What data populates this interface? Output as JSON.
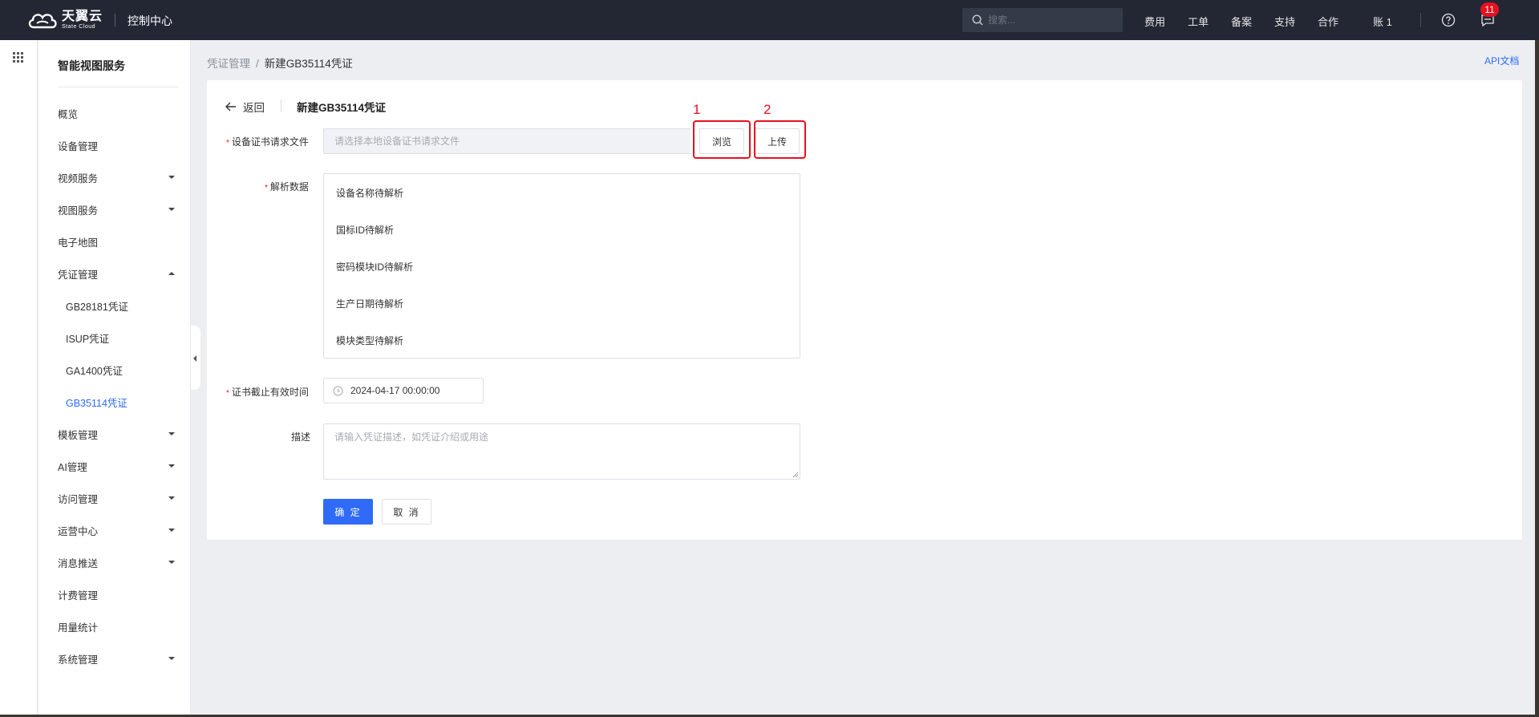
{
  "topbar": {
    "logo_cn": "天翼云",
    "logo_en": "State Cloud",
    "console_title": "控制中心",
    "search_placeholder": "搜索...",
    "nav": [
      "费用",
      "工单",
      "备案",
      "支持",
      "合作"
    ],
    "account_label": "账 1",
    "notification_count": "11"
  },
  "sidebar": {
    "title": "智能视图服务",
    "items": [
      {
        "label": "概览",
        "expandable": false
      },
      {
        "label": "设备管理",
        "expandable": false
      },
      {
        "label": "视频服务",
        "expandable": true
      },
      {
        "label": "视图服务",
        "expandable": true
      },
      {
        "label": "电子地图",
        "expandable": false
      },
      {
        "label": "凭证管理",
        "expandable": true,
        "expanded": true
      },
      {
        "label": "GB28181凭证",
        "sub": true
      },
      {
        "label": "ISUP凭证",
        "sub": true
      },
      {
        "label": "GA1400凭证",
        "sub": true
      },
      {
        "label": "GB35114凭证",
        "sub": true,
        "active": true
      },
      {
        "label": "模板管理",
        "expandable": true
      },
      {
        "label": "AI管理",
        "expandable": true
      },
      {
        "label": "访问管理",
        "expandable": true
      },
      {
        "label": "运营中心",
        "expandable": true
      },
      {
        "label": "消息推送",
        "expandable": true
      },
      {
        "label": "计费管理",
        "expandable": false
      },
      {
        "label": "用量统计",
        "expandable": false
      },
      {
        "label": "系统管理",
        "expandable": true
      }
    ]
  },
  "breadcrumb": {
    "parent": "凭证管理",
    "separator": "/",
    "current": "新建GB35114凭证"
  },
  "api_doc_label": "API文档",
  "form": {
    "back_label": "返回",
    "title": "新建GB35114凭证",
    "file_label": "设备证书请求文件",
    "file_placeholder": "请选择本地设备证书请求文件",
    "browse_label": "浏览",
    "upload_label": "上传",
    "parse_label": "解析数据",
    "parse_items": [
      "设备名称待解析",
      "国标ID待解析",
      "密码模块ID待解析",
      "生产日期待解析",
      "模块类型待解析"
    ],
    "expiry_label": "证书截止有效时间",
    "expiry_value": "2024-04-17 00:00:00",
    "desc_label": "描述",
    "desc_placeholder": "请输入凭证描述，如凭证介绍或用途",
    "confirm_label": "确 定",
    "cancel_label": "取 消"
  },
  "annotations": {
    "mark_1": "1",
    "mark_2": "2",
    "color": "#e8101f"
  },
  "colors": {
    "accent": "#2f6bf6",
    "topbar": "#232734",
    "required": "#e8101f"
  }
}
